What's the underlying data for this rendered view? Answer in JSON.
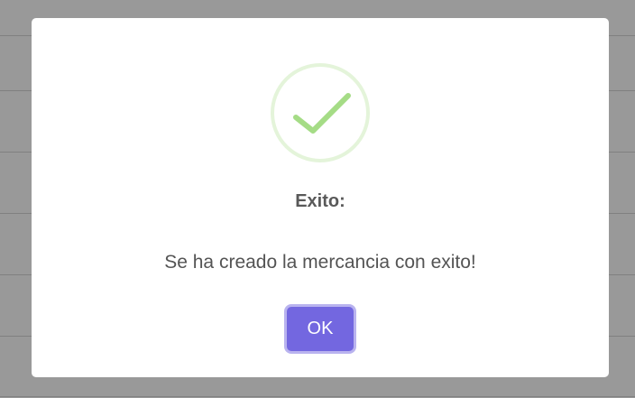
{
  "dialog": {
    "title": "Exito:",
    "message": "Se ha creado la mercancia con exito!",
    "ok_label": "OK",
    "icon": "success-check-icon"
  },
  "colors": {
    "check": "#a5dc86",
    "button": "#7367e0",
    "title_text": "#595959",
    "message_text": "#545454"
  }
}
